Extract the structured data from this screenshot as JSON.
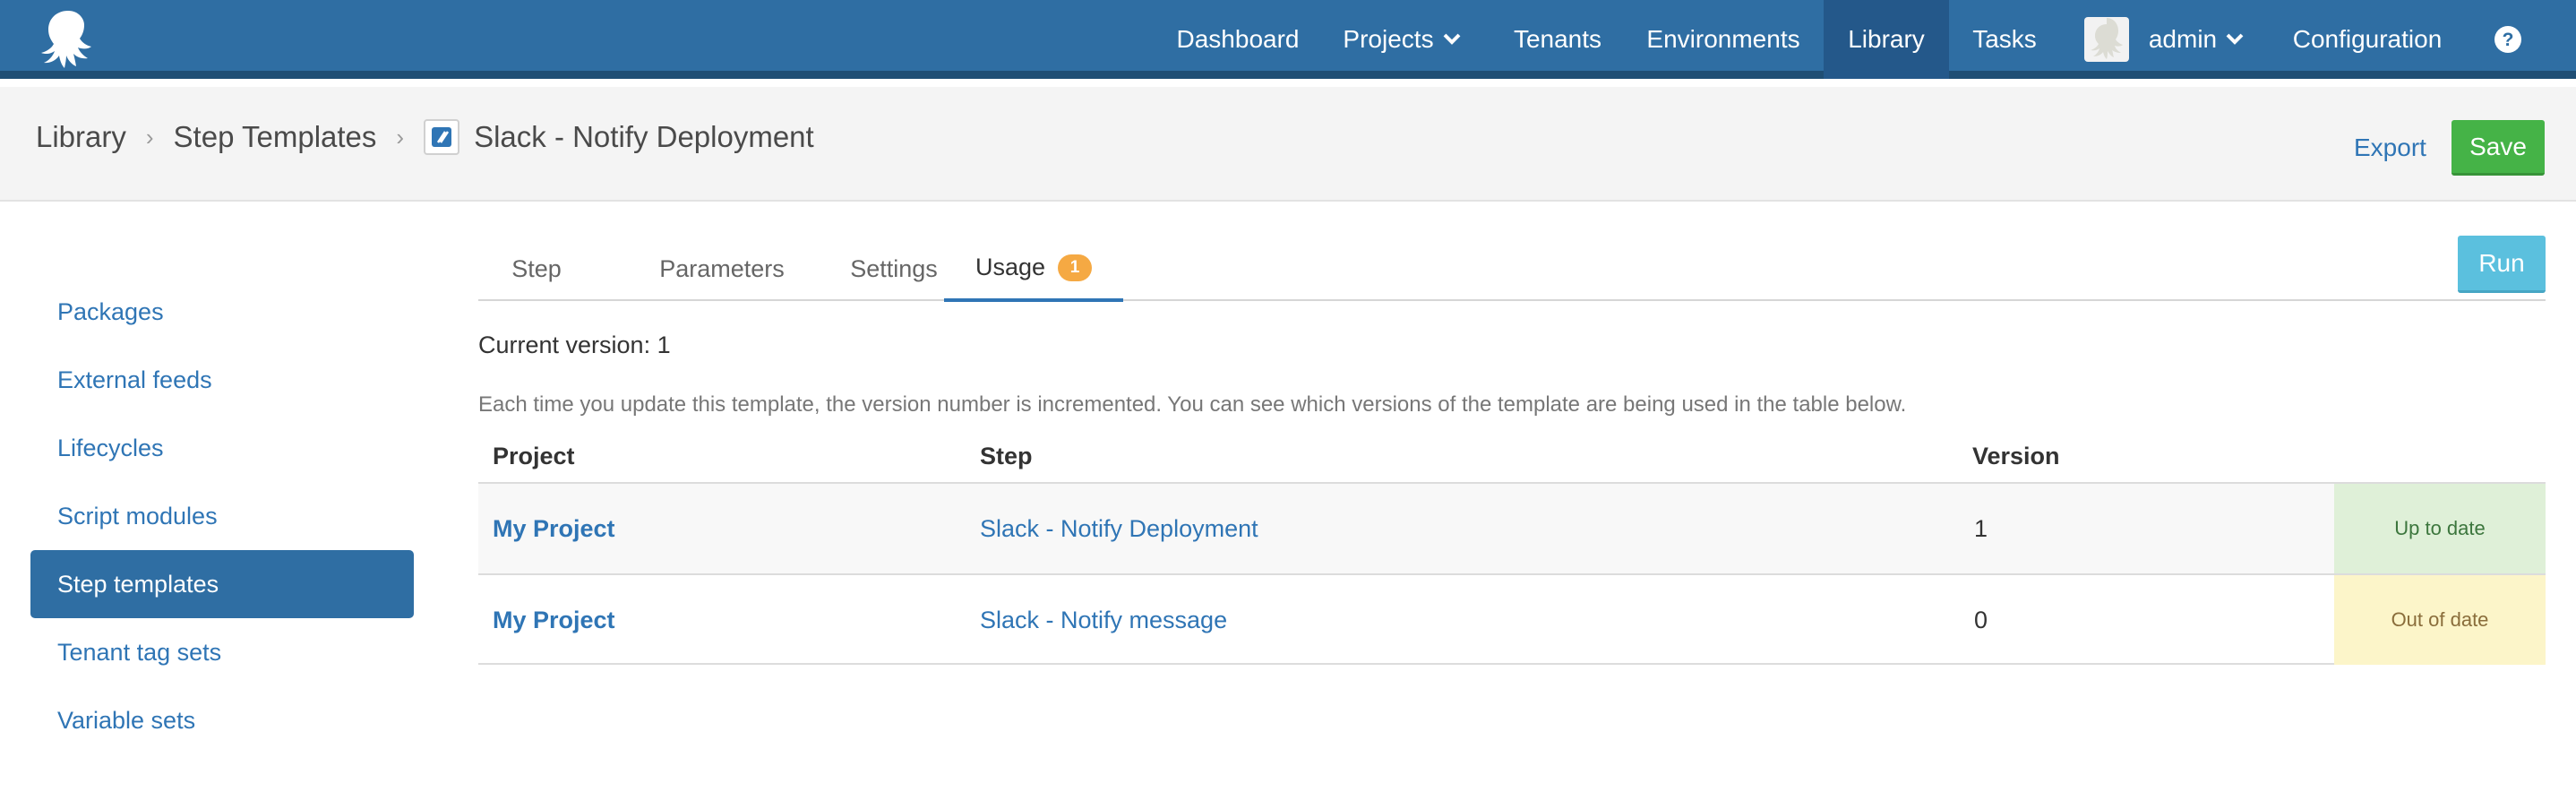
{
  "nav": {
    "items": [
      {
        "label": "Dashboard"
      },
      {
        "label": "Projects"
      },
      {
        "label": "Tenants"
      },
      {
        "label": "Environments"
      },
      {
        "label": "Library"
      },
      {
        "label": "Tasks"
      },
      {
        "label": "admin"
      },
      {
        "label": "Configuration"
      }
    ],
    "active": "Library",
    "icons": [
      "octopus-logo-icon",
      "chevron-down-icon",
      "avatar-icon",
      "help-icon"
    ]
  },
  "breadcrumb": {
    "items": [
      "Library",
      "Step Templates"
    ],
    "current": "Slack - Notify Deployment",
    "separator": "›",
    "template_icon": "step-template-icon"
  },
  "actions": {
    "export_label": "Export",
    "save_label": "Save",
    "run_label": "Run"
  },
  "sidebar": {
    "items": [
      {
        "label": "Packages"
      },
      {
        "label": "External feeds"
      },
      {
        "label": "Lifecycles"
      },
      {
        "label": "Script modules"
      },
      {
        "label": "Step templates"
      },
      {
        "label": "Tenant tag sets"
      },
      {
        "label": "Variable sets"
      }
    ],
    "active": "Step templates"
  },
  "tabs": {
    "items": [
      {
        "label": "Step"
      },
      {
        "label": "Parameters"
      },
      {
        "label": "Settings"
      },
      {
        "label": "Usage",
        "badge": "1"
      }
    ],
    "active": "Usage"
  },
  "usage": {
    "current_version": "Current version: 1",
    "help_text": "Each time you update this template, the version number is incremented. You can see which versions of the template are being used in the table below.",
    "columns": [
      "Project",
      "Step",
      "Version"
    ],
    "rows": [
      {
        "project": "My Project",
        "step": "Slack - Notify Deployment",
        "version": "1",
        "status": "Up to date"
      },
      {
        "project": "My Project",
        "step": "Slack - Notify message",
        "version": "0",
        "status": "Out of date"
      }
    ]
  },
  "colors": {
    "nav_bg": "#2f6ea3",
    "link": "#2f75b5",
    "save": "#45b347",
    "run": "#5bc0de",
    "badge": "#f5a943",
    "up_to_date_bg": "#dff0d8",
    "out_of_date_bg": "#fcf5c9"
  }
}
